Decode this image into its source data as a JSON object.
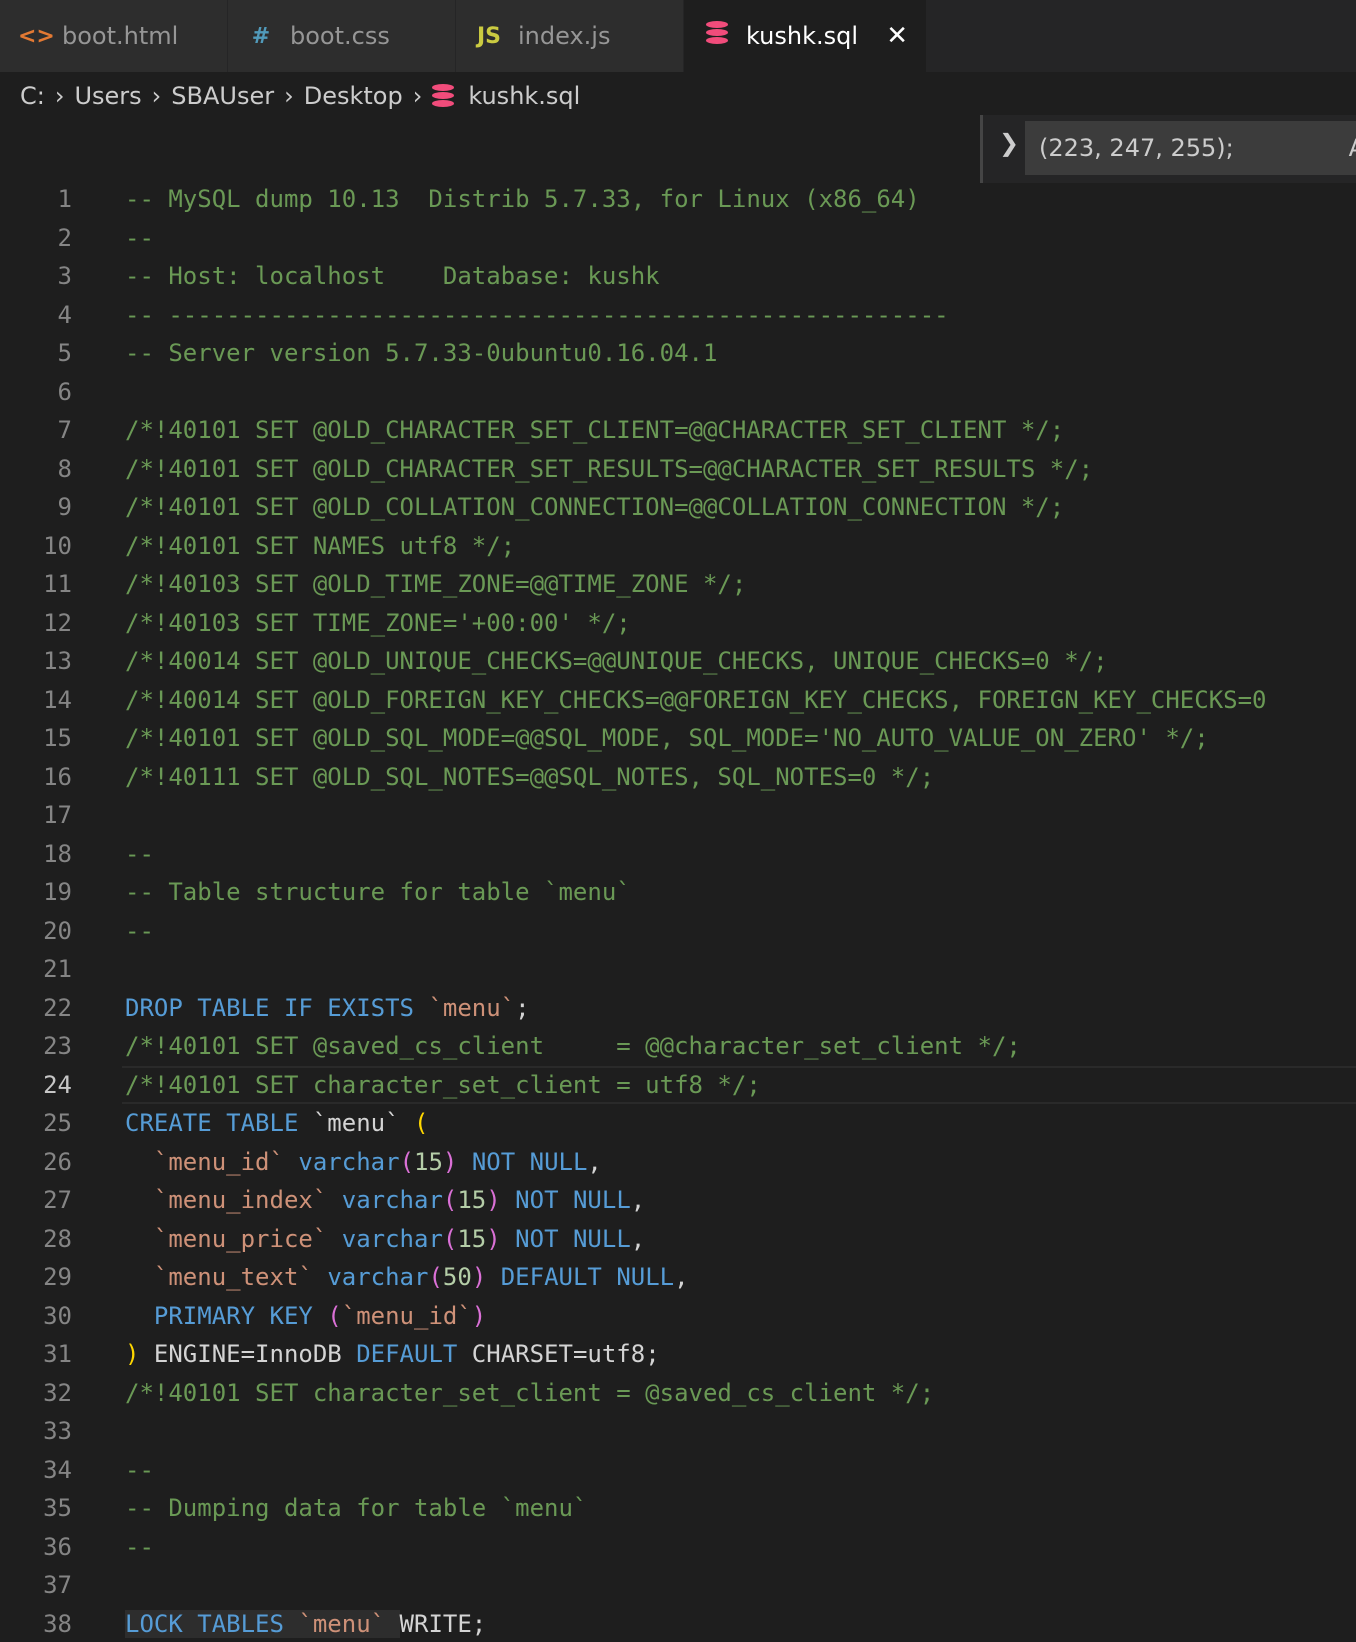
{
  "tabs": [
    {
      "label": "boot.html",
      "icon": "html-icon",
      "glyph": "<>",
      "color": "#e37933"
    },
    {
      "label": "boot.css",
      "icon": "css-icon",
      "glyph": "#",
      "color": "#519aba"
    },
    {
      "label": "index.js",
      "icon": "js-icon",
      "glyph": "JS",
      "color": "#cbcb41"
    },
    {
      "label": "kushk.sql",
      "icon": "database-icon",
      "color": "#f14c7b",
      "active": true
    }
  ],
  "tab_close_glyph": "✕",
  "breadcrumb": [
    "C:",
    "Users",
    "SBAUser",
    "Desktop",
    "kushk.sql"
  ],
  "find_widget": {
    "value": "(223, 247, 255);",
    "overflow_letter": "A"
  },
  "current_line": 24,
  "lines": [
    [
      [
        "c",
        "-- MySQL dump 10.13  Distrib 5.7.33, for Linux (x86_64)"
      ]
    ],
    [
      [
        "c",
        "--"
      ]
    ],
    [
      [
        "c",
        "-- Host: localhost    Database: kushk"
      ]
    ],
    [
      [
        "c",
        "-- ------------------------------------------------------"
      ]
    ],
    [
      [
        "c",
        "-- Server version 5.7.33-0ubuntu0.16.04.1"
      ]
    ],
    [],
    [
      [
        "c",
        "/*!40101 SET @OLD_CHARACTER_SET_CLIENT=@@CHARACTER_SET_CLIENT */;"
      ]
    ],
    [
      [
        "c",
        "/*!40101 SET @OLD_CHARACTER_SET_RESULTS=@@CHARACTER_SET_RESULTS */;"
      ]
    ],
    [
      [
        "c",
        "/*!40101 SET @OLD_COLLATION_CONNECTION=@@COLLATION_CONNECTION */;"
      ]
    ],
    [
      [
        "c",
        "/*!40101 SET NAMES utf8 */;"
      ]
    ],
    [
      [
        "c",
        "/*!40103 SET @OLD_TIME_ZONE=@@TIME_ZONE */;"
      ]
    ],
    [
      [
        "c",
        "/*!40103 SET TIME_ZONE='+00:00' */;"
      ]
    ],
    [
      [
        "c",
        "/*!40014 SET @OLD_UNIQUE_CHECKS=@@UNIQUE_CHECKS, UNIQUE_CHECKS=0 */;"
      ]
    ],
    [
      [
        "c",
        "/*!40014 SET @OLD_FOREIGN_KEY_CHECKS=@@FOREIGN_KEY_CHECKS, FOREIGN_KEY_CHECKS=0"
      ]
    ],
    [
      [
        "c",
        "/*!40101 SET @OLD_SQL_MODE=@@SQL_MODE, SQL_MODE='NO_AUTO_VALUE_ON_ZERO' */;"
      ]
    ],
    [
      [
        "c",
        "/*!40111 SET @OLD_SQL_NOTES=@@SQL_NOTES, SQL_NOTES=0 */;"
      ]
    ],
    [],
    [
      [
        "c",
        "--"
      ]
    ],
    [
      [
        "c",
        "-- Table structure for table `menu`"
      ]
    ],
    [
      [
        "c",
        "--"
      ]
    ],
    [],
    [
      [
        "k",
        "DROP TABLE IF EXISTS "
      ],
      [
        "s",
        "`menu`"
      ],
      [
        "t",
        ";"
      ]
    ],
    [
      [
        "c",
        "/*!40101 SET @saved_cs_client     = @@character_set_client */;"
      ]
    ],
    [
      [
        "c",
        "/*!40101 SET character_set_client = utf8 */;"
      ]
    ],
    [
      [
        "k",
        "CREATE TABLE "
      ],
      [
        "t",
        "`menu` "
      ],
      [
        "p1",
        "("
      ]
    ],
    [
      [
        "t",
        "  "
      ],
      [
        "s",
        "`menu_id`"
      ],
      [
        "t",
        " "
      ],
      [
        "k",
        "varchar"
      ],
      [
        "p2",
        "("
      ],
      [
        "n",
        "15"
      ],
      [
        "p2",
        ")"
      ],
      [
        "t",
        " "
      ],
      [
        "k",
        "NOT NULL"
      ],
      [
        "t",
        ","
      ]
    ],
    [
      [
        "t",
        "  "
      ],
      [
        "s",
        "`menu_index`"
      ],
      [
        "t",
        " "
      ],
      [
        "k",
        "varchar"
      ],
      [
        "p2",
        "("
      ],
      [
        "n",
        "15"
      ],
      [
        "p2",
        ")"
      ],
      [
        "t",
        " "
      ],
      [
        "k",
        "NOT NULL"
      ],
      [
        "t",
        ","
      ]
    ],
    [
      [
        "t",
        "  "
      ],
      [
        "s",
        "`menu_price`"
      ],
      [
        "t",
        " "
      ],
      [
        "k",
        "varchar"
      ],
      [
        "p2",
        "("
      ],
      [
        "n",
        "15"
      ],
      [
        "p2",
        ")"
      ],
      [
        "t",
        " "
      ],
      [
        "k",
        "NOT NULL"
      ],
      [
        "t",
        ","
      ]
    ],
    [
      [
        "t",
        "  "
      ],
      [
        "s",
        "`menu_text`"
      ],
      [
        "t",
        " "
      ],
      [
        "k",
        "varchar"
      ],
      [
        "p2",
        "("
      ],
      [
        "n",
        "50"
      ],
      [
        "p2",
        ")"
      ],
      [
        "t",
        " "
      ],
      [
        "k",
        "DEFAULT NULL"
      ],
      [
        "t",
        ","
      ]
    ],
    [
      [
        "t",
        "  "
      ],
      [
        "k",
        "PRIMARY KEY "
      ],
      [
        "p2",
        "("
      ],
      [
        "s",
        "`menu_id`"
      ],
      [
        "p2",
        ")"
      ]
    ],
    [
      [
        "p1",
        ")"
      ],
      [
        "t",
        " ENGINE=InnoDB "
      ],
      [
        "k",
        "DEFAULT"
      ],
      [
        "t",
        " CHARSET=utf8;"
      ]
    ],
    [
      [
        "c",
        "/*!40101 SET character_set_client = @saved_cs_client */;"
      ]
    ],
    [],
    [
      [
        "c",
        "--"
      ]
    ],
    [
      [
        "c",
        "-- Dumping data for table `menu`"
      ]
    ],
    [
      [
        "c",
        "--"
      ]
    ],
    [],
    [
      [
        "lock",
        "LOCK TABLES "
      ],
      [
        "slock",
        "`menu` "
      ],
      [
        "t",
        "WRITE;"
      ]
    ]
  ]
}
